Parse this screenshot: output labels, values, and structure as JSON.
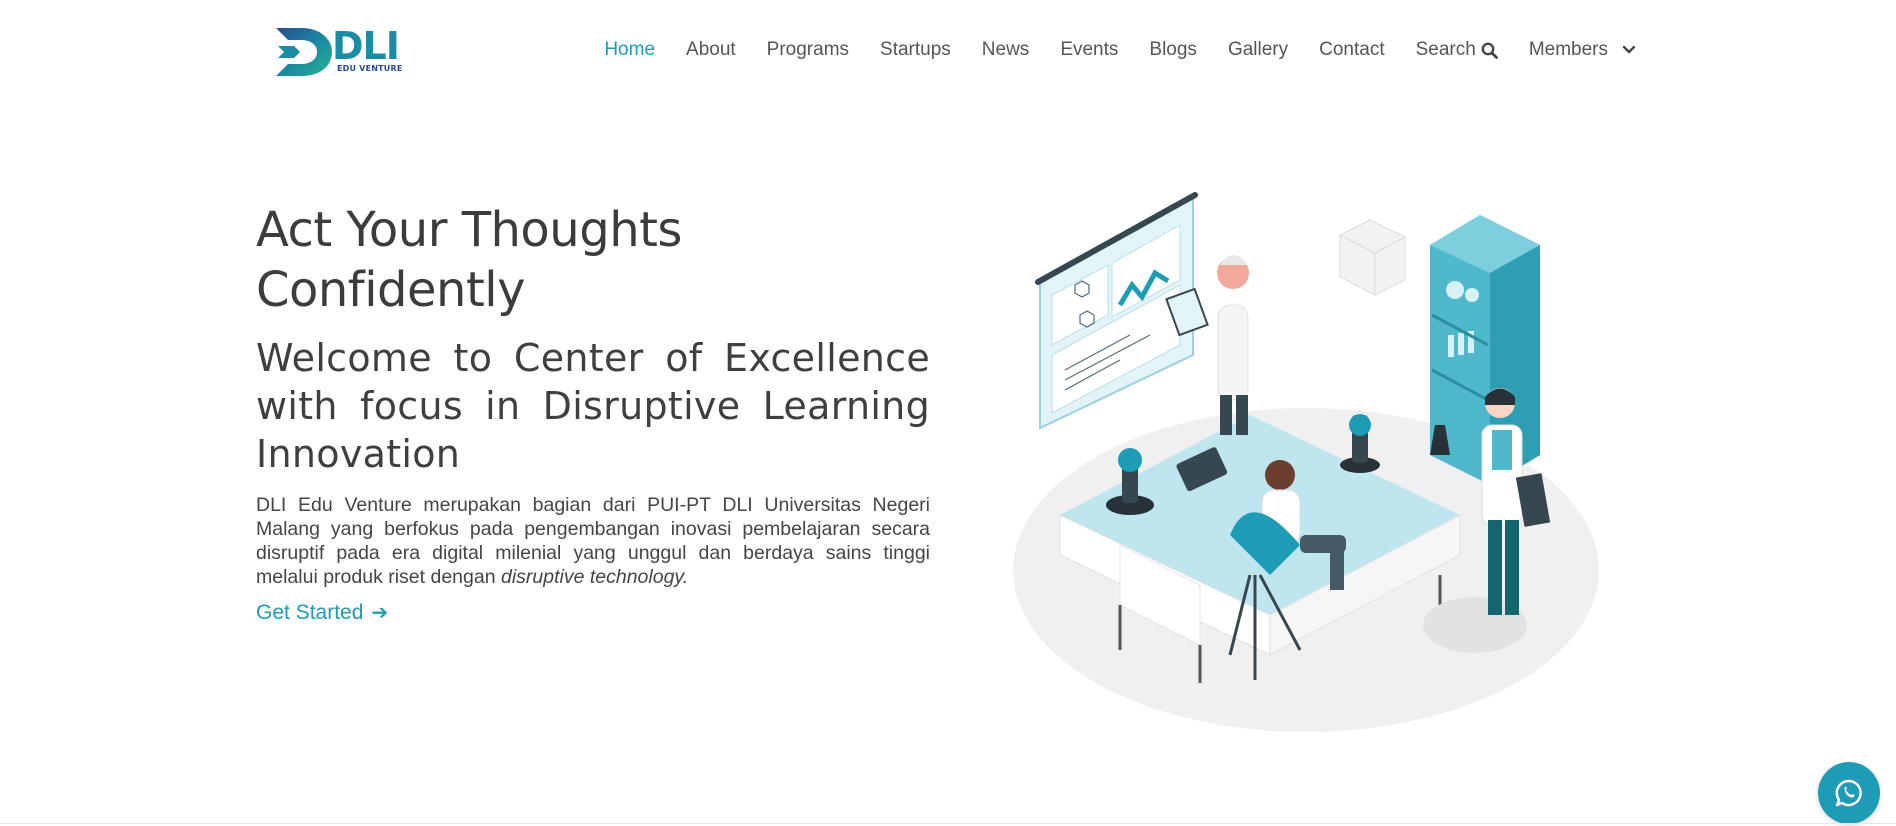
{
  "logo": {
    "mark": "DLI",
    "tagline": "EDU VENTURE"
  },
  "nav": {
    "items": [
      {
        "label": "Home",
        "active": true
      },
      {
        "label": "About"
      },
      {
        "label": "Programs"
      },
      {
        "label": "Startups"
      },
      {
        "label": "News"
      },
      {
        "label": "Events"
      },
      {
        "label": "Blogs"
      },
      {
        "label": "Gallery"
      },
      {
        "label": "Contact"
      }
    ],
    "search_label": "Search",
    "members_label": "Members"
  },
  "hero": {
    "title": "Act Your Thoughts Confidently",
    "subtitle": "Welcome to Center of Excellence with focus in Disruptive Learning Innovation",
    "description": "DLI Edu Venture merupakan bagian dari PUI-PT DLI Universitas Negeri Malang yang berfokus pada pengembangan inovasi pembelajaran secara disruptif pada era digital milenial yang unggul dan berdaya sains tinggi melalui produk riset dengan",
    "description_emphasis": "disruptive technology.",
    "cta_label": "Get Started",
    "cta_arrow": "➔"
  },
  "colors": {
    "accent": "#1e9bb5",
    "text": "#444444",
    "logo_blue": "#2a4b8c"
  },
  "icons": {
    "search": "search-icon",
    "members_dropdown": "chevron-down-icon",
    "whatsapp": "whatsapp-icon"
  }
}
